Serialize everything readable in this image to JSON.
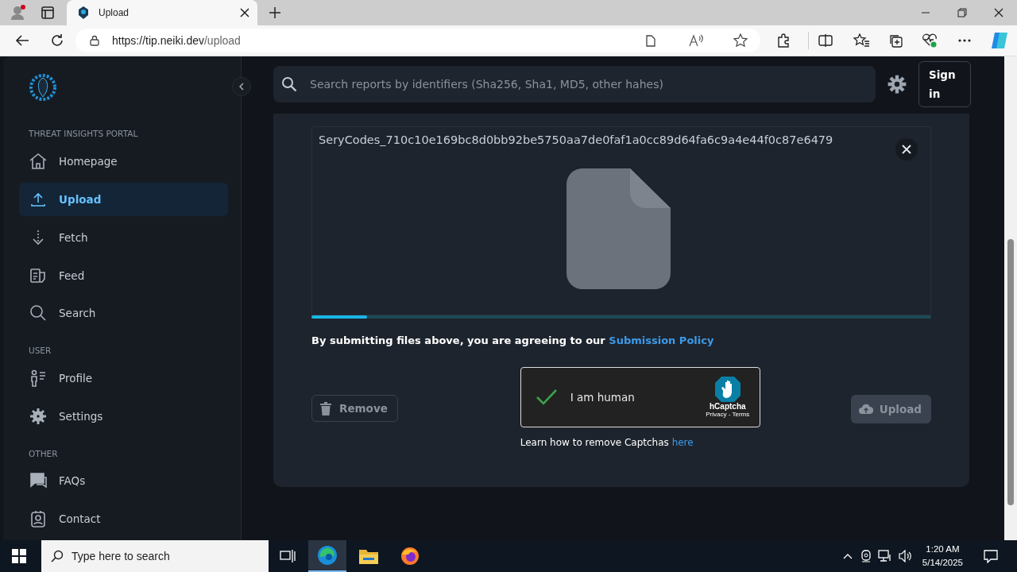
{
  "browser": {
    "tab_title": "Upload",
    "url_host": "https://tip.neiki.dev",
    "url_path": "/upload"
  },
  "sidebar": {
    "sections": [
      {
        "title": "THREAT INSIGHTS PORTAL",
        "items": [
          {
            "label": "Homepage",
            "selected": false
          },
          {
            "label": "Upload",
            "selected": true
          },
          {
            "label": "Fetch",
            "selected": false
          },
          {
            "label": "Feed",
            "selected": false
          },
          {
            "label": "Search",
            "selected": false
          }
        ]
      },
      {
        "title": "USER",
        "items": [
          {
            "label": "Profile",
            "selected": false
          },
          {
            "label": "Settings",
            "selected": false
          }
        ]
      },
      {
        "title": "OTHER",
        "items": [
          {
            "label": "FAQs",
            "selected": false
          },
          {
            "label": "Contact",
            "selected": false
          }
        ]
      }
    ]
  },
  "header": {
    "search": {
      "placeholder": "Search reports by identifiers (Sha256, Sha1, MD5, other hahes)"
    },
    "sign_in": "Sign in"
  },
  "upload": {
    "file_name": "SeryCodes_710c10e169bc8d0bb92be5750aa7de0faf1a0cc89d64fa6c9a4e44f0c87e6479",
    "progress": {
      "level": 0.09
    },
    "policy_text": "By submitting files above, you are agreeing to our",
    "policy_link": "Submission Policy",
    "remove_button": "Remove",
    "captcha": {
      "label": "I am human",
      "checked": true,
      "brand": "hCaptcha",
      "privacy": "Privacy",
      "separator": " - ",
      "terms": "Terms"
    },
    "upload_button": {
      "label": "Upload",
      "disabled": true
    },
    "captcha_help": "Learn how to remove Captchas",
    "captcha_help_link": "here"
  },
  "taskbar": {
    "search_placeholder": "Type here to search",
    "time": "1:20 AM",
    "date": "5/14/2025"
  }
}
